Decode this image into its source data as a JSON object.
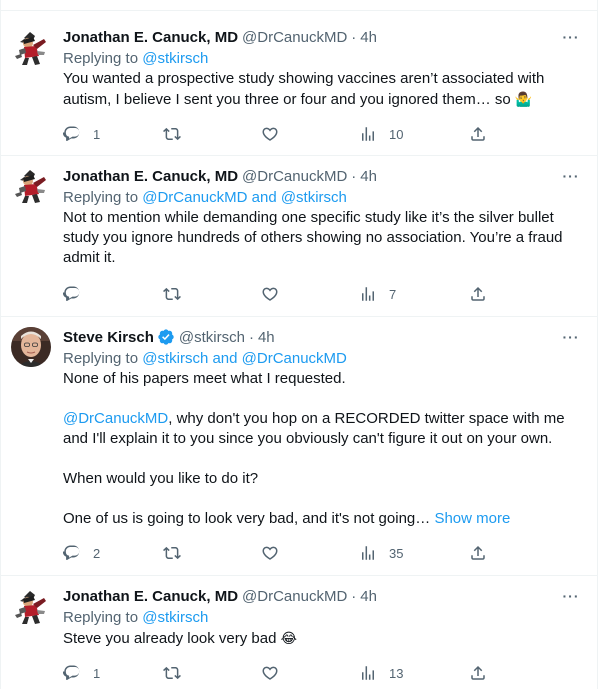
{
  "tweets": [
    {
      "name": "Jonathan E. Canuck, MD",
      "handle": "@DrCanuckMD",
      "dot": "·",
      "time": "4h",
      "reply_prefix": "Replying to ",
      "reply_to": "@stkirsch",
      "text": "You wanted a prospective study showing vaccines aren’t associated with autism, I believe I sent you three or four and you ignored them… so",
      "emoji": "🤷‍♂️",
      "replies": "1",
      "retweets": "",
      "likes": "",
      "views": "10",
      "avatar": "canuck-avatar"
    },
    {
      "name": "Jonathan E. Canuck, MD",
      "handle": "@DrCanuckMD",
      "dot": "·",
      "time": "4h",
      "reply_prefix": "Replying to ",
      "reply_to": "@DrCanuckMD and @stkirsch",
      "text": "Not to mention while demanding one specific study like it’s the silver bullet study you ignore hundreds of others showing no association. You’re a fraud admit it.",
      "replies": "",
      "retweets": "",
      "likes": "",
      "views": "7",
      "avatar": "canuck-avatar"
    },
    {
      "name": "Steve Kirsch",
      "handle": "@stkirsch",
      "dot": "·",
      "time": "4h",
      "verified": true,
      "reply_prefix": "Replying to ",
      "reply_to": "@stkirsch and @DrCanuckMD",
      "para1": "None of his papers meet what I requested.",
      "mention": "@DrCanuckMD",
      "para2_rest": ", why don't you hop on a RECORDED twitter space with me and I'll explain it to you since you obviously can't figure it out on your own.",
      "para3": "When would you like to do it?",
      "para4": "One of us is going to look very bad, and it's not going…",
      "show_more": "Show more",
      "replies": "2",
      "retweets": "",
      "likes": "",
      "views": "35",
      "avatar": "kirsch-avatar"
    },
    {
      "name": "Jonathan E. Canuck, MD",
      "handle": "@DrCanuckMD",
      "dot": "·",
      "time": "4h",
      "reply_prefix": "Replying to ",
      "reply_to": "@stkirsch",
      "text": "Steve you already look very bad",
      "emoji": "😂",
      "replies": "1",
      "retweets": "",
      "likes": "",
      "views": "13",
      "avatar": "canuck-avatar"
    }
  ],
  "colors": {
    "link": "#1d9bf0",
    "secondary": "#536471",
    "text": "#0f1419",
    "divider": "#eff3f4"
  },
  "more_glyph": "···"
}
